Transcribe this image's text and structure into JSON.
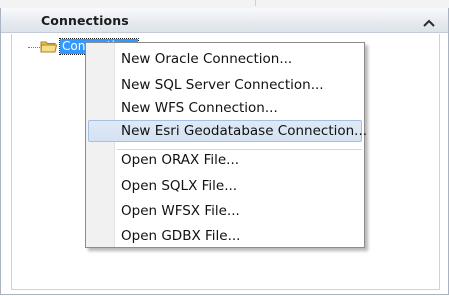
{
  "panel": {
    "title": "Connections"
  },
  "tree": {
    "root_label": "Connections"
  },
  "context_menu": {
    "items": [
      {
        "label": "New Oracle Connection..."
      },
      {
        "label": "New SQL Server Connection..."
      },
      {
        "label": "New WFS Connection..."
      },
      {
        "label": "New Esri Geodatabase Connection...",
        "highlighted": true
      },
      {
        "label": "Open ORAX File..."
      },
      {
        "label": "Open SQLX File..."
      },
      {
        "label": "Open WFSX File..."
      },
      {
        "label": "Open GDBX File..."
      }
    ]
  },
  "colors": {
    "selection": "#3399ff",
    "highlight_border": "#a5c0e2",
    "folder": "#f5d76e"
  }
}
